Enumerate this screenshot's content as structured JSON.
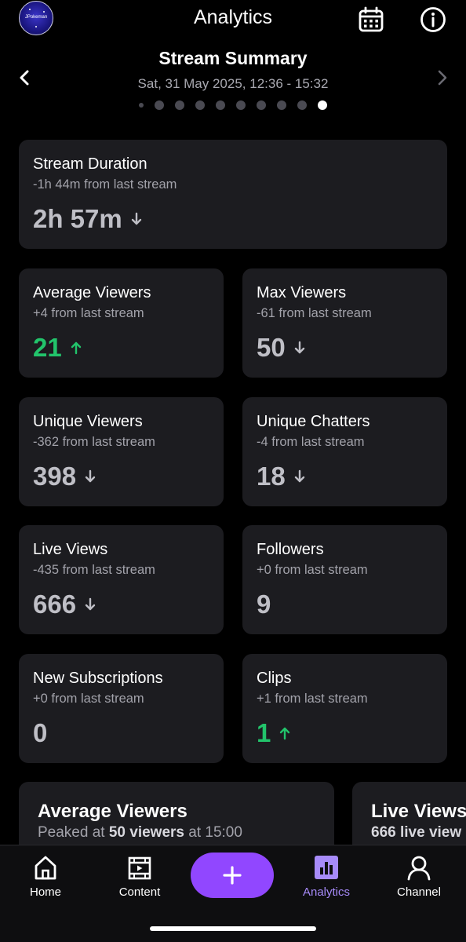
{
  "header": {
    "title": "Analytics",
    "avatar_name": "JPokeman"
  },
  "summary": {
    "title": "Stream Summary",
    "date": "Sat, 31 May 2025, 12:36 - 15:32",
    "pages_total": 10,
    "active_page": 10
  },
  "stats": {
    "duration": {
      "title": "Stream Duration",
      "sub": "-1h 44m from last stream",
      "value": "2h 57m",
      "trend": "down"
    },
    "avg_viewers": {
      "title": "Average Viewers",
      "sub": "+4 from last stream",
      "value": "21",
      "trend": "up"
    },
    "max_viewers": {
      "title": "Max Viewers",
      "sub": "-61 from last stream",
      "value": "50",
      "trend": "down"
    },
    "unique_viewers": {
      "title": "Unique Viewers",
      "sub": "-362 from last stream",
      "value": "398",
      "trend": "down"
    },
    "unique_chatters": {
      "title": "Unique Chatters",
      "sub": "-4 from last stream",
      "value": "18",
      "trend": "down"
    },
    "live_views": {
      "title": "Live Views",
      "sub": "-435 from last stream",
      "value": "666",
      "trend": "down"
    },
    "followers": {
      "title": "Followers",
      "sub": "+0 from last stream",
      "value": "9",
      "trend": "none"
    },
    "new_subs": {
      "title": "New Subscriptions",
      "sub": "+0 from last stream",
      "value": "0",
      "trend": "none"
    },
    "clips": {
      "title": "Clips",
      "sub": "+1 from last stream",
      "value": "1",
      "trend": "up"
    }
  },
  "charts": {
    "avg": {
      "title": "Average Viewers",
      "sub_prefix": "Peaked at ",
      "sub_bold": "50 viewers",
      "sub_suffix": " at 15:00"
    },
    "live": {
      "title": "Live Views",
      "sub_bold": "666 live view"
    }
  },
  "nav": {
    "home": "Home",
    "content": "Content",
    "analytics": "Analytics",
    "channel": "Channel",
    "active": "analytics"
  },
  "colors": {
    "accent": "#9147ff",
    "up": "#22c46b",
    "down": "#bfbfc6",
    "card": "#1c1c20",
    "active_nav": "#a78bfa"
  },
  "icons": [
    "calendar-icon",
    "info-icon",
    "chevron-left-icon",
    "chevron-right-icon",
    "arrow-up-icon",
    "arrow-down-icon",
    "home-icon",
    "content-icon",
    "plus-icon",
    "analytics-icon",
    "channel-icon"
  ]
}
